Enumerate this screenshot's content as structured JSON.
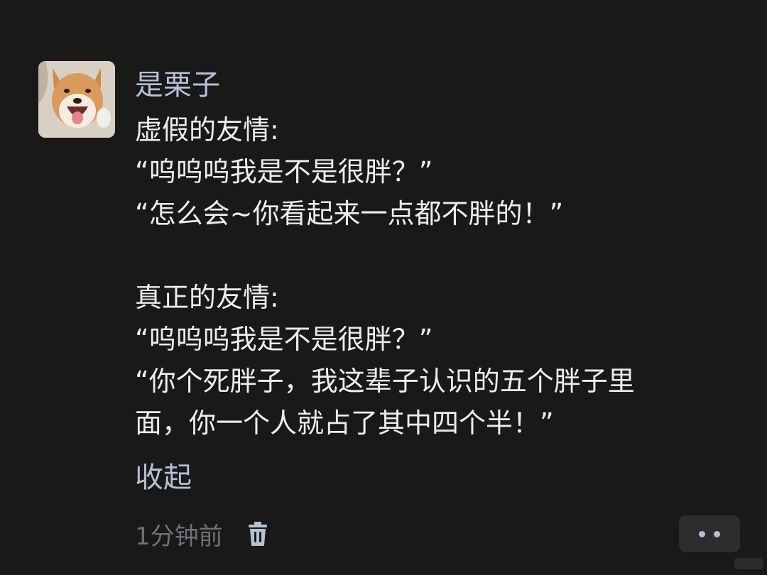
{
  "comment": {
    "username": "是栗子",
    "lines": [
      "虚假的友情:",
      "“呜呜呜我是不是很胖？”",
      "“怎么会~你看起来一点都不胖的！”",
      "",
      "真正的友情:",
      "“呜呜呜我是不是很胖？”",
      "“你个死胖子，我这辈子认识的五个胖子里",
      "面，你一个人就占了其中四个半！”"
    ],
    "collapse_label": "收起",
    "timestamp": "1分钟前"
  },
  "icons": {
    "avatar": "shiba-dog-avatar",
    "delete": "trash-icon",
    "more": "more-dots-icon"
  },
  "colors": {
    "background": "#19191a",
    "text": "#ededed",
    "accent": "#b6c0d4",
    "muted": "#6f7177"
  }
}
